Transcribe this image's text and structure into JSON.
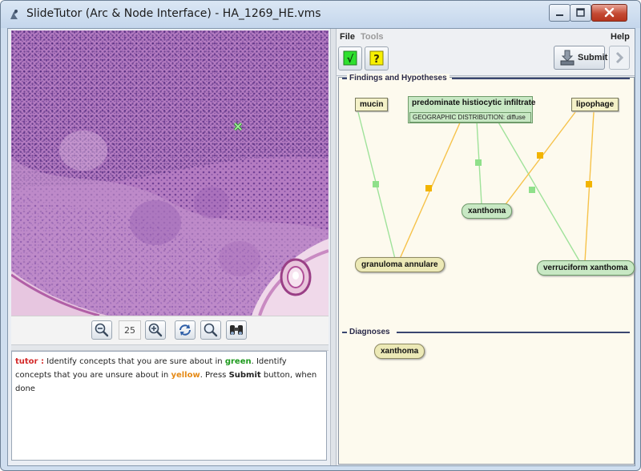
{
  "window": {
    "title": "SlideTutor (Arc & Node Interface) - HA_1269_HE.vms"
  },
  "slide_toolbar": {
    "zoom_value": "25"
  },
  "tutor_message": {
    "speaker": "tutor :",
    "part1": " Identify concepts that you are sure about in ",
    "green_word": "green",
    "part2": ". Identify concepts that you are unsure about in ",
    "yellow_word": "yellow",
    "part3": ". Press ",
    "submit_word": "Submit",
    "part4": " button, when done"
  },
  "menu": {
    "file": "File",
    "tools": "Tools",
    "help": "Help"
  },
  "right_toolbar": {
    "confirm_glyph": "√",
    "question_glyph": "?",
    "submit_label": "Submit"
  },
  "findings": {
    "title": "Findings and Hypotheses",
    "nodes": {
      "mucin": "mucin",
      "infiltrate": "predominate histiocytic infiltrate",
      "infiltrate_attribute": "GEOGRAPHIC DISTRIBUTION: diffuse",
      "lipophage": "lipophage",
      "xanthoma": "xanthoma",
      "granuloma": "granuloma annulare",
      "verruciform": "verruciform xanthoma"
    }
  },
  "diagnoses": {
    "title": "Diagnoses",
    "node": "xanthoma"
  },
  "colors": {
    "supports_link": "#9fe29a",
    "support_marker": "#8fe08a",
    "refutes_link": "#f6c24a",
    "refute_marker": "#f2b400"
  },
  "icons": [
    "app-logo-icon",
    "minimize-icon",
    "maximize-icon",
    "close-icon",
    "zoom-out-icon",
    "zoom-in-icon",
    "rotate-icon",
    "magnifier-icon",
    "binoculars-icon",
    "checkmark-icon",
    "question-icon",
    "submit-tray-icon",
    "next-arrow-icon"
  ]
}
